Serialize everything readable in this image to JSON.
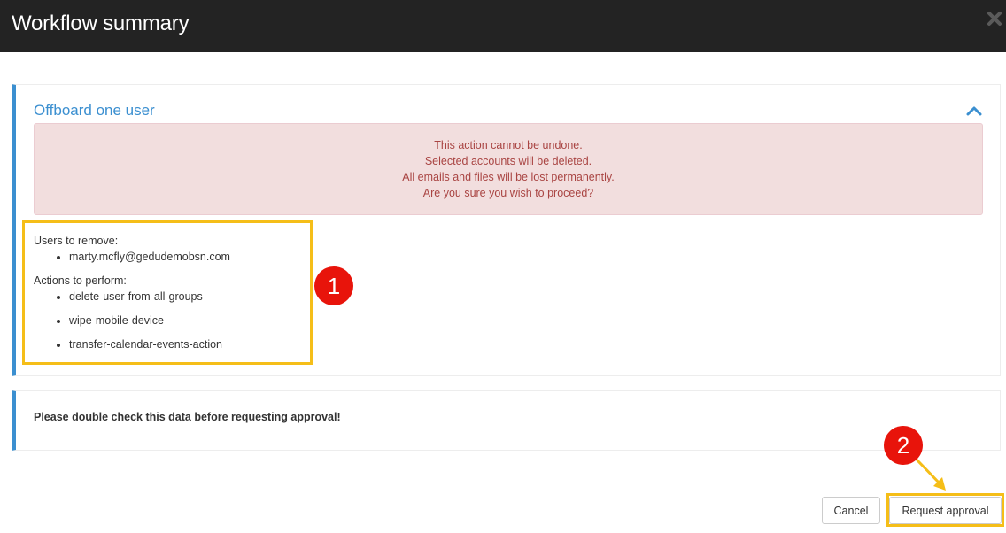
{
  "dialog": {
    "title": "Workflow summary",
    "close_icon": "close-x-icon"
  },
  "workflow": {
    "title": "Offboard one user",
    "collapse_icon": "chevron-up-icon",
    "warning": {
      "lines": [
        "This action cannot be undone.",
        "Selected accounts will be deleted.",
        "All emails and files will be lost permanently.",
        "Are you sure you wish to proceed?"
      ]
    },
    "users_label": "Users to remove:",
    "users": [
      "marty.mcfly@gedudemobsn.com"
    ],
    "actions_label": "Actions to perform:",
    "actions": [
      "delete-user-from-all-groups",
      "wipe-mobile-device",
      "transfer-calendar-events-action"
    ]
  },
  "notice": "Please double check this data before requesting approval!",
  "footer": {
    "cancel_label": "Cancel",
    "approve_label": "Request approval"
  },
  "annotations": {
    "badge1": "1",
    "badge2": "2",
    "highlight_color": "#f5be18",
    "badge_color": "#e8140b"
  },
  "colors": {
    "header_bg": "#232323",
    "accent": "#3b8fd0",
    "alert_bg": "#f2dede",
    "alert_text": "#a94442"
  }
}
